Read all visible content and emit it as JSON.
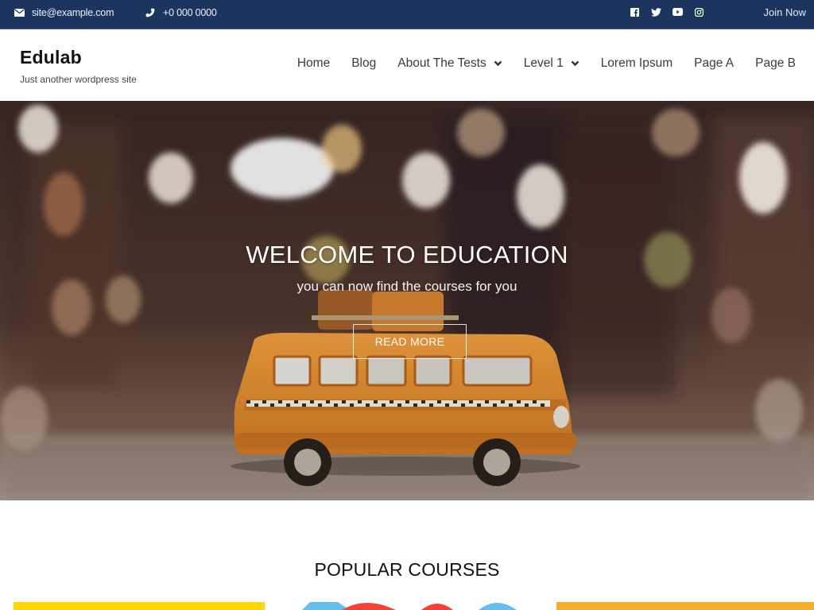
{
  "topbar": {
    "email": "site@example.com",
    "phone": "+0 000 0000",
    "social": [
      {
        "icon": "facebook-icon"
      },
      {
        "icon": "twitter-icon"
      },
      {
        "icon": "youtube-icon"
      },
      {
        "icon": "instagram-icon"
      }
    ],
    "join_label": "Join Now",
    "colors": {
      "background": "#1c355e"
    }
  },
  "header": {
    "site_title": "Edulab",
    "tagline": "Just another wordpress site"
  },
  "nav": {
    "items": [
      {
        "label": "Home",
        "has_dropdown": false
      },
      {
        "label": "Blog",
        "has_dropdown": false
      },
      {
        "label": "About The Tests",
        "has_dropdown": true
      },
      {
        "label": "Level 1",
        "has_dropdown": true
      },
      {
        "label": "Lorem Ipsum",
        "has_dropdown": false
      },
      {
        "label": "Page A",
        "has_dropdown": false
      },
      {
        "label": "Page B",
        "has_dropdown": false
      }
    ]
  },
  "hero": {
    "title": "WELCOME TO EDUCATION",
    "subtitle": "you can now find the courses for you",
    "button_label": "READ MORE",
    "image": "toy orange bus on bokeh street background"
  },
  "courses": {
    "title": "POPULAR COURSES",
    "card_colors": [
      "#fdd502",
      "#64bdea",
      "#f44336",
      "#f44336",
      "#64bdea",
      "#f5ab2b"
    ]
  }
}
